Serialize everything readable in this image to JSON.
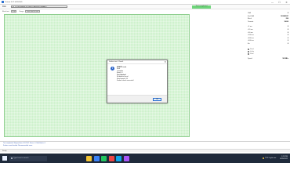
{
  "window": {
    "title": "Victoria 5.37 HDD/SSD",
    "controls": [
      "—",
      "☐",
      "✕"
    ]
  },
  "toolbar": {
    "disk_label": "Disk",
    "device": "[0] 76 GB Maxtor 6Y080P0 (A0/HDD/SMART)",
    "status": "Test completed"
  },
  "subbar": {
    "mode_label": "Block test",
    "mode_value": "Grid",
    "range_label": "Range",
    "range_value": "from start to end"
  },
  "side_panel": {
    "rows": [
      {
        "label": "LBA",
        "value": "0"
      },
      {
        "label": "End LBA",
        "value": "160086527"
      },
      {
        "label": "Block",
        "value": "256"
      },
      {
        "label": "Timeout",
        "value": "10000"
      }
    ],
    "stats": [
      {
        "label": "<5 ms",
        "value": "0"
      },
      {
        "label": "<20 ms",
        "value": "0"
      },
      {
        "label": "<50 ms",
        "value": "0"
      },
      {
        "label": "<200 ms",
        "value": "0"
      },
      {
        "label": "<600 ms",
        "value": "0"
      },
      {
        "label": ">600 ms",
        "value": "0"
      },
      {
        "label": "Err",
        "value": "0"
      }
    ],
    "checks": [
      "Read",
      "Verify",
      "Write"
    ],
    "speed_label": "Speed",
    "speed_value": "58 MB/s"
  },
  "dialog": {
    "title": "Surface test - Result",
    "close": "✕",
    "heading": "SMART: reset",
    "lines": [
      "Start",
      "Complete",
      "Errors: 0",
      "Test finished",
      "No defects found",
      "Read speed: OK",
      "Surface check successful"
    ],
    "ok_label": "OK",
    "info_glyph": "i"
  },
  "log": {
    "lines": [
      "Test completed. Elapsed time: 00:22:41. Errors: 0. Bad blocks: 0.",
      "Surface scan finished. Recommended: none."
    ]
  },
  "statusbar": {
    "text": "Ready"
  },
  "taskbar": {
    "search_placeholder": "Type here to search",
    "weather": "73°F  Light rain",
    "time": "1:29 PM",
    "date": "8/25/2022",
    "app_colors": [
      "#f1c232",
      "#3b82f6",
      "#22c55e",
      "#ef4444",
      "#0ea5e9",
      "#a855f7"
    ]
  }
}
